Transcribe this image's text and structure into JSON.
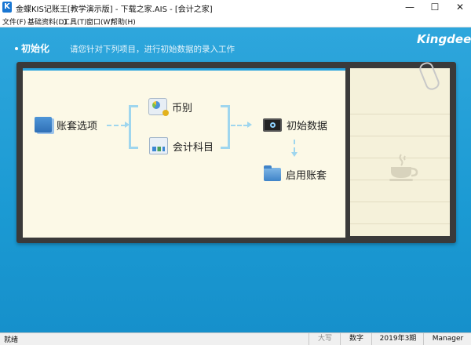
{
  "window": {
    "title": "金蝶KIS记账王[教学演示版] - 下载之家.AIS - [会计之家]",
    "controls": {
      "minimize": "—",
      "maximize": "☐",
      "close": "✕"
    }
  },
  "menu": [
    {
      "label": "文件(F)"
    },
    {
      "label": "基础资料(D)"
    },
    {
      "label": "工具(T)"
    },
    {
      "label": "窗口(W)"
    },
    {
      "label": "帮助(H)"
    }
  ],
  "header": {
    "section_title": "初始化",
    "description": "请您针对下列项目，进行初始数据的录入工作",
    "brand": "Kingdee"
  },
  "workflow": {
    "account_options": {
      "label": "账套选项",
      "icon": "ledger-icon"
    },
    "currency": {
      "label": "币别",
      "icon": "currency-icon"
    },
    "accounts": {
      "label": "会计科目",
      "icon": "chart-icon"
    },
    "initial_data": {
      "label": "初始数据",
      "icon": "monitor-icon"
    },
    "enable_account": {
      "label": "启用账套",
      "icon": "folder-icon"
    }
  },
  "statusbar": {
    "status": "就绪",
    "caps": "大写",
    "num": "数字",
    "period": "2019年3期",
    "user": "Manager"
  },
  "colors": {
    "background": "#1a9ad3",
    "panel": "#fcf9e7",
    "frame": "#3a3a3a",
    "connector": "#9fd6ee"
  }
}
